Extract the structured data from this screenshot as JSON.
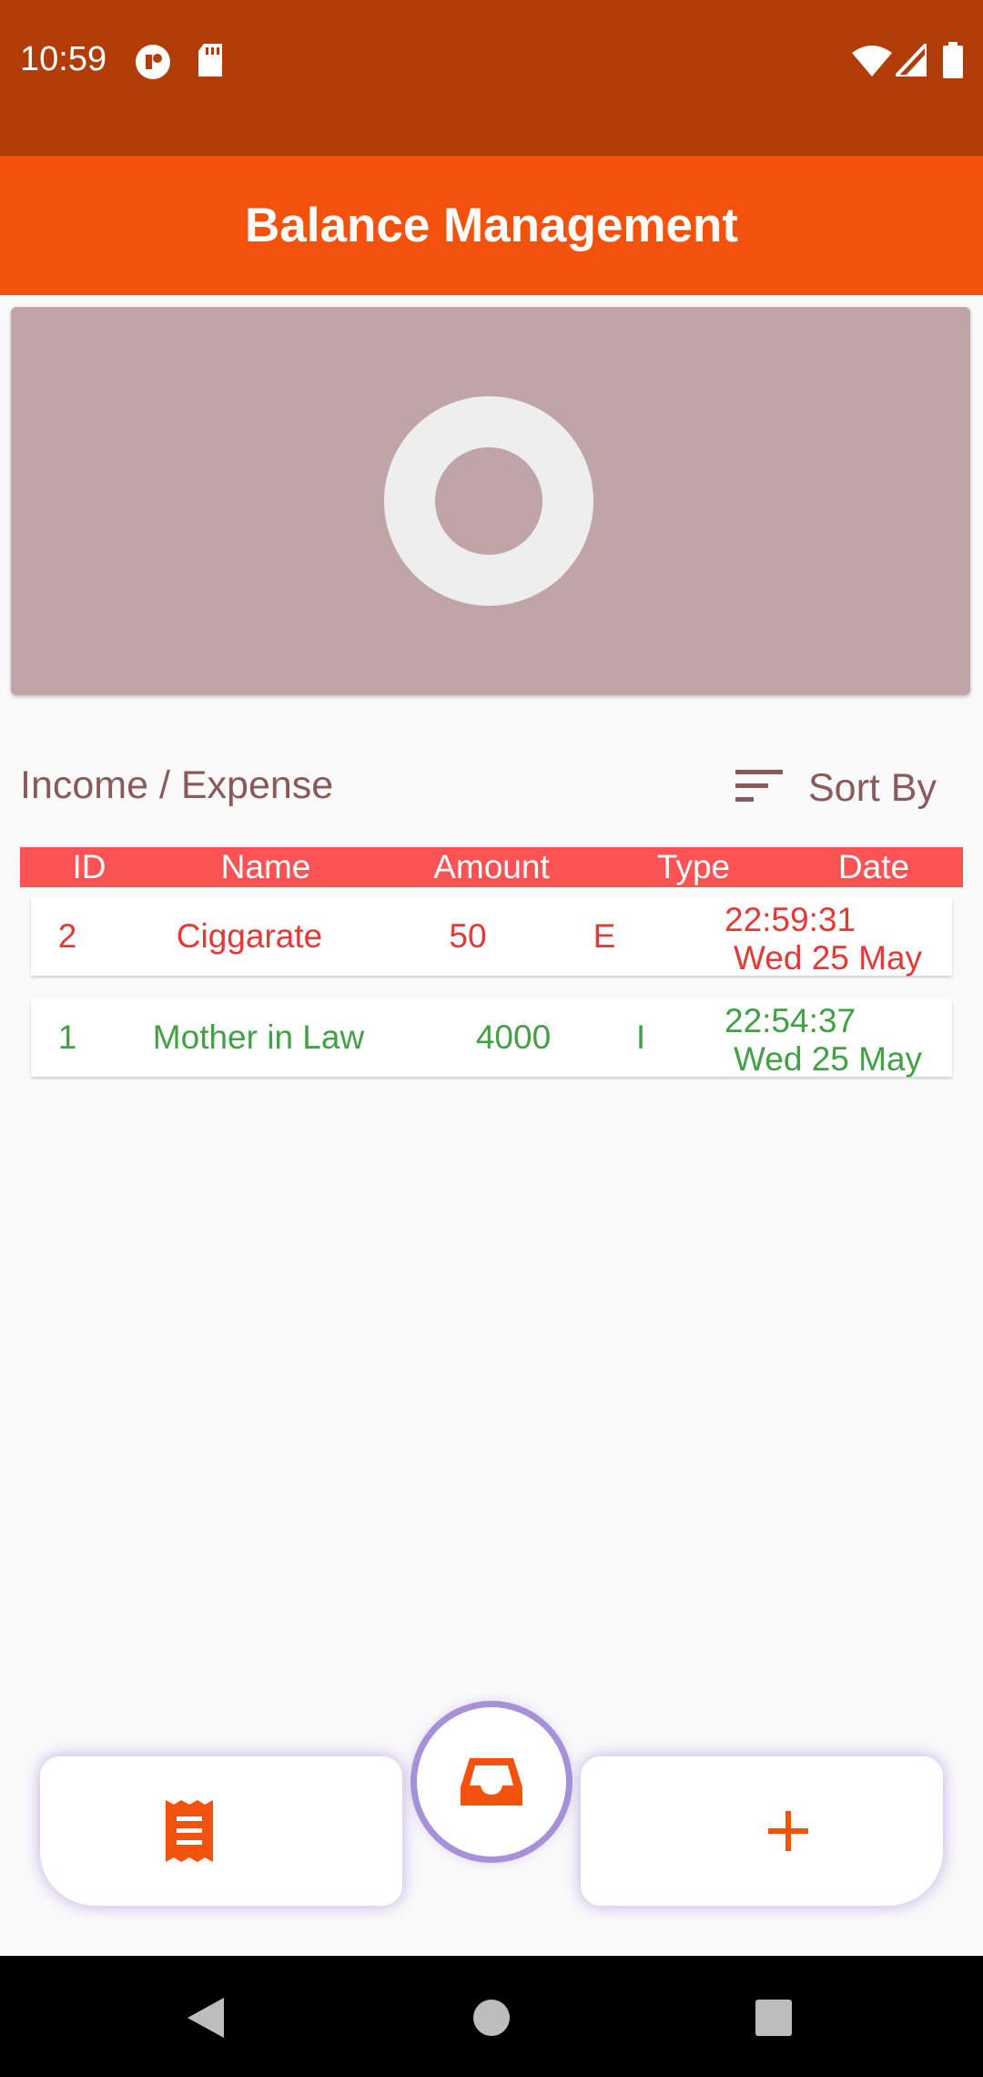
{
  "status_bar": {
    "time": "10:59",
    "icons": [
      "notification-app-icon",
      "sd-card-icon",
      "wifi-icon",
      "signal-icon",
      "battery-icon"
    ]
  },
  "app_bar": {
    "title": "Balance Management"
  },
  "chart": {
    "type": "donut",
    "state": "empty"
  },
  "list_header": {
    "label": "Income / Expense",
    "sort_label": "Sort By"
  },
  "table": {
    "columns": [
      "ID",
      "Name",
      "Amount",
      "Type",
      "Date"
    ],
    "rows": [
      {
        "id": "2",
        "name": "Ciggarate",
        "amount": "50",
        "type": "E",
        "time": "22:59:31",
        "date": "Wed 25 May",
        "kind": "expense",
        "color": "#E53935"
      },
      {
        "id": "1",
        "name": "Mother in Law",
        "amount": "4000",
        "type": "I",
        "time": "22:54:37",
        "date": "Wed 25 May",
        "kind": "income",
        "color": "#43A047"
      }
    ]
  },
  "bottom_nav": {
    "items": [
      "receipt-icon",
      "inbox-icon",
      "add-icon"
    ],
    "accent": "#F2520B"
  },
  "colors": {
    "status_bar": "#B23C06",
    "app_bar": "#F2520B",
    "table_header": "#FB5354",
    "chart_bg": "#BFA5A7"
  }
}
